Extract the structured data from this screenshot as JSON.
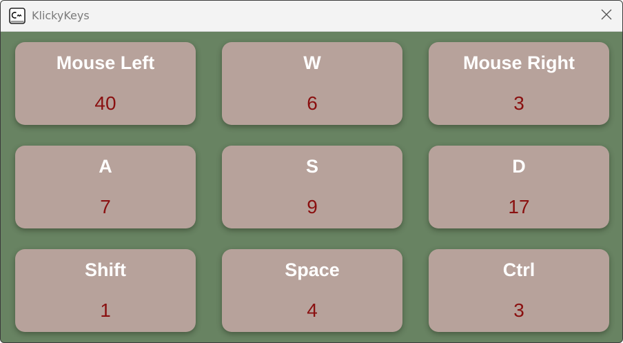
{
  "window": {
    "title": "KlickyKeys",
    "icon": "keyboard-key-icon",
    "close_icon": "close-icon"
  },
  "colors": {
    "background": "#688362",
    "card": "#b7a29b",
    "key_label": "#ffffff",
    "count": "#8a1010",
    "titlebar": "#f3f3f3"
  },
  "keys": [
    {
      "name": "Mouse Left",
      "count": "40"
    },
    {
      "name": "W",
      "count": "6"
    },
    {
      "name": "Mouse Right",
      "count": "3"
    },
    {
      "name": "A",
      "count": "7"
    },
    {
      "name": "S",
      "count": "9"
    },
    {
      "name": "D",
      "count": "17"
    },
    {
      "name": "Shift",
      "count": "1"
    },
    {
      "name": "Space",
      "count": "4"
    },
    {
      "name": "Ctrl",
      "count": "3"
    }
  ]
}
